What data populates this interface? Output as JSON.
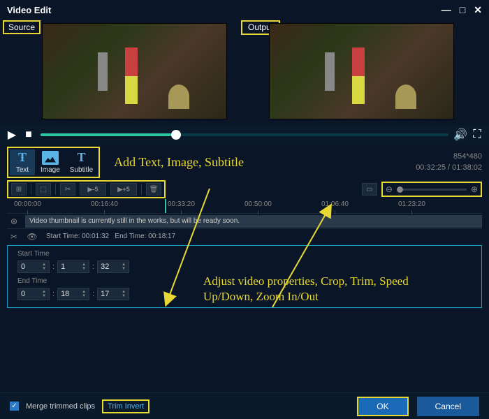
{
  "window": {
    "title": "Video Edit"
  },
  "previews": {
    "source_label": "Source",
    "output_label": "Output"
  },
  "tools": {
    "text": "Text",
    "image": "Image",
    "subtitle": "Subtitle",
    "annotation": "Add Text, Image, Subtitle"
  },
  "meta": {
    "resolution": "854*480",
    "time": "00:32:25 / 01:38:02"
  },
  "speed": {
    "down": "▶-5",
    "up": "▶+5"
  },
  "timeline": {
    "ticks": [
      "00:00:00",
      "00:16:40",
      "00:33:20",
      "00:50:00",
      "01:06:40",
      "01:23:20"
    ]
  },
  "tracks": {
    "thumb_msg": "Video thumbnail is currently still in the works, but will be ready soon.",
    "start_label": "Start Time:",
    "start_val": "00:01:32",
    "end_label": "End Time:",
    "end_val": "00:18:17"
  },
  "props": {
    "start_label": "Start Time",
    "end_label": "End Time",
    "start": {
      "h": "0",
      "m": "1",
      "s": "32"
    },
    "end": {
      "h": "0",
      "m": "18",
      "s": "17"
    },
    "annotation": "Adjust video properties, Crop, Trim, Speed Up/Down, Zoom In/Out"
  },
  "footer": {
    "merge": "Merge trimmed clips",
    "trim_invert": "Trim Invert",
    "ok": "OK",
    "cancel": "Cancel"
  }
}
